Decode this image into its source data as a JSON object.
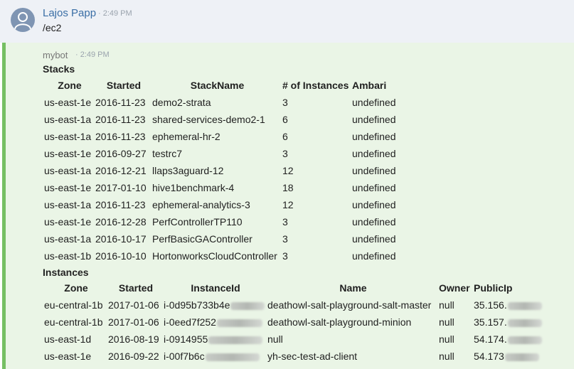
{
  "user_message": {
    "username": "Lajos Papp",
    "time": "· 2:49 PM",
    "text": "/ec2"
  },
  "bot_message": {
    "name": "mybot",
    "time": "· 2:49 PM",
    "accent_color": "#76bf63",
    "stacks": {
      "title": "Stacks",
      "headers": [
        "Zone",
        "Started",
        "StackName",
        "# of Instances",
        "Ambari"
      ],
      "rows": [
        [
          "us-east-1e",
          "2016-11-23",
          "demo2-strata",
          "3",
          "undefined"
        ],
        [
          "us-east-1a",
          "2016-11-23",
          "shared-services-demo2-1",
          "6",
          "undefined"
        ],
        [
          "us-east-1a",
          "2016-11-23",
          "ephemeral-hr-2",
          "6",
          "undefined"
        ],
        [
          "us-east-1e",
          "2016-09-27",
          "testrc7",
          "3",
          "undefined"
        ],
        [
          "us-east-1a",
          "2016-12-21",
          "llaps3aguard-12",
          "12",
          "undefined"
        ],
        [
          "us-east-1e",
          "2017-01-10",
          "hive1benchmark-4",
          "18",
          "undefined"
        ],
        [
          "us-east-1a",
          "2016-11-23",
          "ephemeral-analytics-3",
          "12",
          "undefined"
        ],
        [
          "us-east-1e",
          "2016-12-28",
          "PerfControllerTP110",
          "3",
          "undefined"
        ],
        [
          "us-east-1a",
          "2016-10-17",
          "PerfBasicGAController",
          "3",
          "undefined"
        ],
        [
          "us-east-1b",
          "2016-10-10",
          "HortonworksCloudController",
          "3",
          "undefined"
        ]
      ]
    },
    "instances": {
      "title": "Instances",
      "headers": [
        "Zone",
        "Started",
        "InstanceId",
        "Name",
        "Owner",
        "PublicIp"
      ],
      "rows": [
        [
          "eu-central-1b",
          "2017-01-06",
          "i-0d95b733b4e",
          "deathowl-salt-playground-salt-master",
          "null",
          "35.156."
        ],
        [
          "eu-central-1b",
          "2017-01-06",
          "i-0eed7f252",
          "deathowl-salt-playground-minion",
          "null",
          "35.157."
        ],
        [
          "us-east-1d",
          "2016-08-19",
          "i-0914955",
          "null",
          "null",
          "54.174."
        ],
        [
          "us-east-1e",
          "2016-09-22",
          "i-00f7b6c",
          "yh-sec-test-ad-client",
          "null",
          "54.173"
        ]
      ]
    }
  }
}
